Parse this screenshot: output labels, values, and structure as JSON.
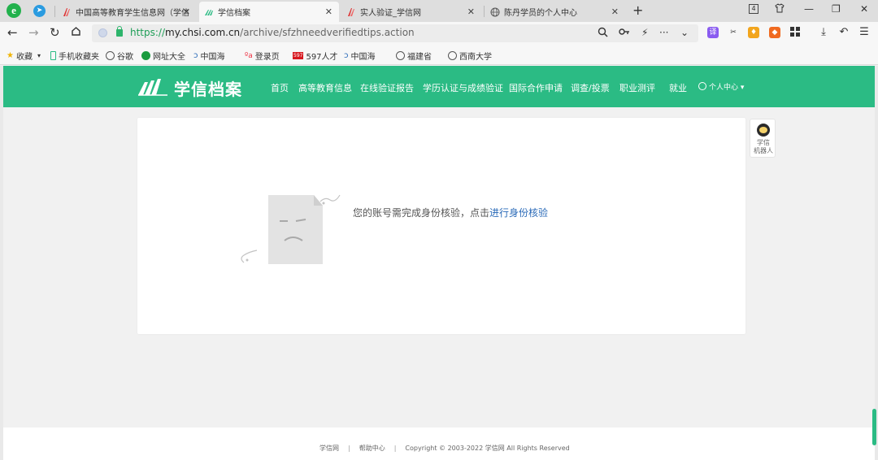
{
  "browser": {
    "tabs": [
      {
        "title": "中国高等教育学生信息网（学信"
      },
      {
        "title": "学信档案"
      },
      {
        "title": "实人验证_学信网"
      },
      {
        "title": "陈丹学员的个人中心"
      }
    ],
    "tab_count": "4",
    "new_tab_icon": "plus-icon",
    "url": {
      "protocol": "https://",
      "host": "my.chsi.com.cn",
      "path": "/archive/sfzhneedverifiedtips.action"
    }
  },
  "bookmarks": [
    {
      "label": "收藏"
    },
    {
      "label": "手机收藏夹"
    },
    {
      "label": "谷歌"
    },
    {
      "label": "网址大全"
    },
    {
      "label": "中国海"
    },
    {
      "label": "登录页"
    },
    {
      "label": "597人才"
    },
    {
      "label": "中国海"
    },
    {
      "label": "福建省"
    },
    {
      "label": "西南大学"
    }
  ],
  "site": {
    "logo": "学信档案",
    "nav": [
      {
        "label": "首页"
      },
      {
        "label": "高等教育信息"
      },
      {
        "label": "在线验证报告"
      },
      {
        "label": "学历认证与成绩验证"
      },
      {
        "label": "国际合作申请"
      },
      {
        "label": "调查/投票"
      },
      {
        "label": "职业测评"
      },
      {
        "label": "就业"
      }
    ],
    "user_menu": "个人中心 ▾",
    "accent_color": "#2bbb84"
  },
  "main": {
    "notice_text": "您的账号需完成身份核验，点击",
    "notice_link": "进行身份核验"
  },
  "robot": {
    "label_line1": "学信",
    "label_line2": "机器人"
  },
  "footer": {
    "link1": "学信网",
    "link2": "帮助中心",
    "copyright": "Copyright © 2003-2022 学信网 All Rights Reserved"
  }
}
